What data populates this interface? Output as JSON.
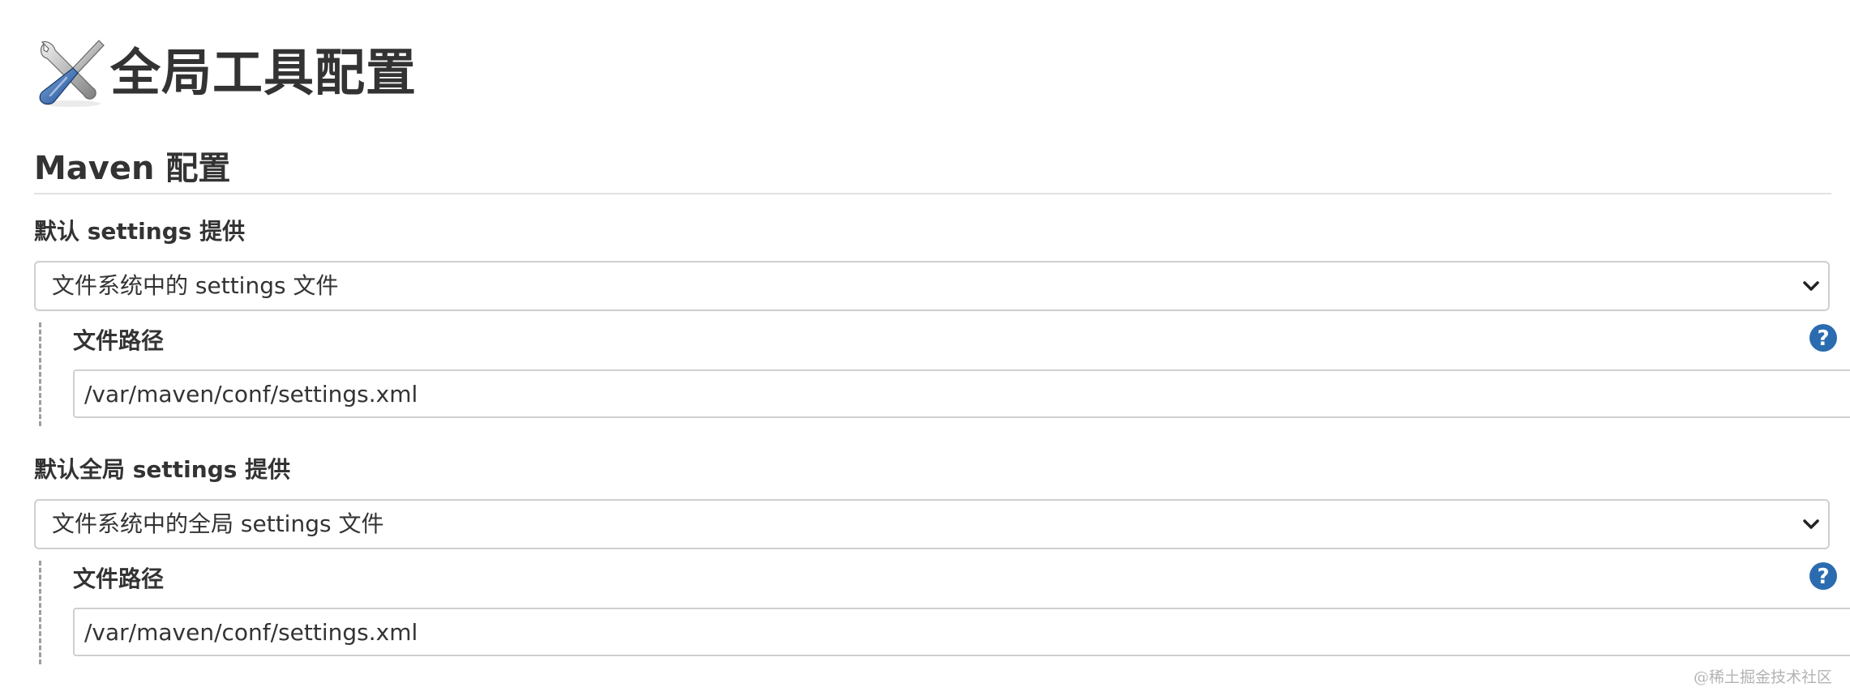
{
  "page": {
    "title": "全局工具配置",
    "title_icon": "tools-icon"
  },
  "maven_section": {
    "title": "Maven 配置",
    "default_settings": {
      "label": "默认 settings 提供",
      "selected": "文件系统中的 settings 文件",
      "file_path_label": "文件路径",
      "file_path_value": "/var/maven/conf/settings.xml"
    },
    "default_global_settings": {
      "label": "默认全局 settings 提供",
      "selected": "文件系统中的全局 settings 文件",
      "file_path_label": "文件路径",
      "file_path_value": "/var/maven/conf/settings.xml"
    }
  },
  "icons": {
    "help": "help-icon",
    "chevron": "chevron-down-icon"
  },
  "colors": {
    "help_blue": "#2b6cb0",
    "text": "#333333",
    "border": "#cfcfcf",
    "dashed_guide": "#9e9e9e"
  },
  "watermark": "@稀土掘金技术社区"
}
